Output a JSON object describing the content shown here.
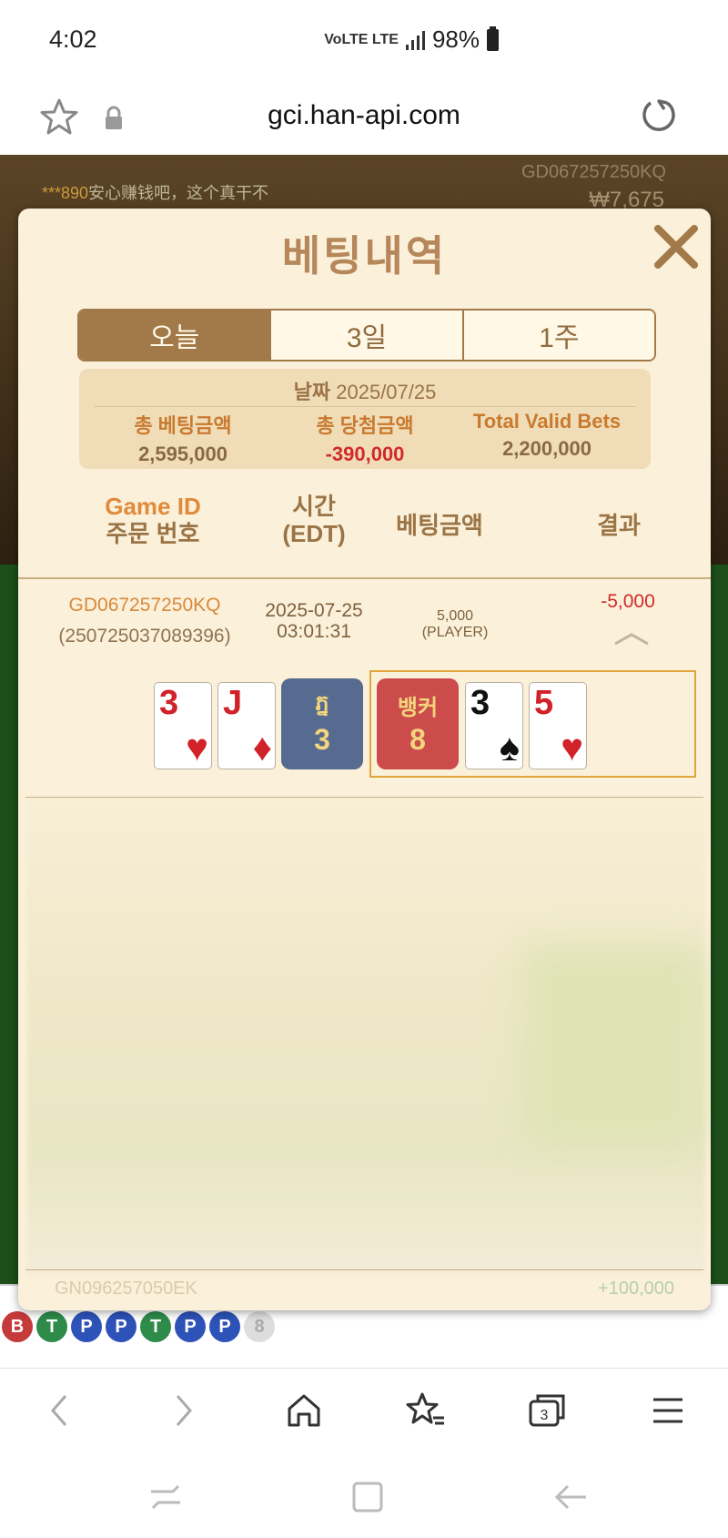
{
  "status_bar": {
    "time": "4:02",
    "network": "VoLTE LTE",
    "battery": "98%"
  },
  "browser": {
    "url": "gci.han-api.com"
  },
  "background": {
    "chat_user": "***890",
    "chat_text": "安心赚钱吧，这个真干不",
    "game_id": "GD067257250KQ",
    "balance": "₩7,675",
    "road": [
      "B",
      "T",
      "P",
      "P",
      "T",
      "P",
      "P",
      "8"
    ]
  },
  "modal": {
    "title": "베팅내역",
    "tabs": [
      "오늘",
      "3일",
      "1주"
    ],
    "summary": {
      "date_label": "날짜",
      "date_value": "2025/07/25",
      "total_bet_label": "총 베팅금액",
      "total_bet_value": "2,595,000",
      "total_win_label": "총 당첨금액",
      "total_win_value": "-390,000",
      "valid_bets_label": "Total Valid Bets",
      "valid_bets_value": "2,200,000"
    },
    "columns": {
      "game_id": "Game ID",
      "order_no": "주문 번호",
      "time": "시간",
      "time_zone": "(EDT)",
      "bet_amount": "베팅금액",
      "result": "결과"
    },
    "record": {
      "game_id": "GD067257250KQ",
      "order_no": "(250725037089396)",
      "date": "2025-07-25",
      "time": "03:01:31",
      "bet_amount": "5,000",
      "bet_side": "(PLAYER)",
      "result": "-5,000",
      "player_cards": [
        {
          "rank": "3",
          "suit": "♥"
        },
        {
          "rank": "J",
          "suit": "♦"
        }
      ],
      "player_label": "ភ្ន",
      "player_score": "3",
      "banker_label": "뱅커",
      "banker_score": "8",
      "banker_cards": [
        {
          "rank": "3",
          "suit": "♠"
        },
        {
          "rank": "5",
          "suit": "♥"
        }
      ]
    },
    "next_row_partial": {
      "game_id": "GN096257050EK",
      "result": "+100,000"
    }
  }
}
